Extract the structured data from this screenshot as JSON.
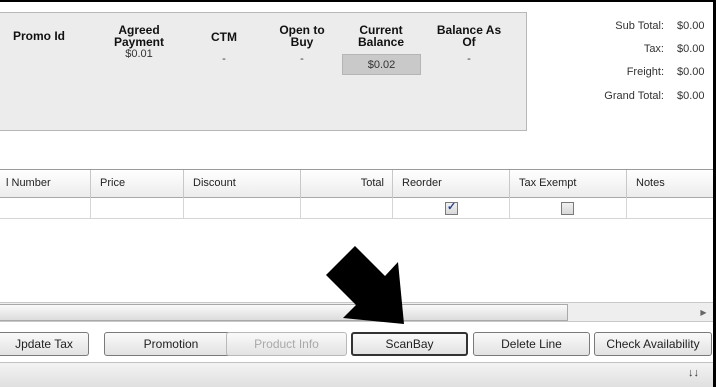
{
  "promo": {
    "headers": {
      "promo_id": "Promo Id",
      "agreed_payment_line1": "Agreed",
      "agreed_payment_line2": "Payment",
      "ctm": "CTM",
      "open_to_buy_line1": "Open to",
      "open_to_buy_line2": "Buy",
      "current_balance_line1": "Current",
      "current_balance_line2": "Balance",
      "balance_as_of_line1": "Balance As",
      "balance_as_of_line2": "Of"
    },
    "values": {
      "agreed_payment": "$0.01",
      "ctm": "-",
      "open_to_buy": "-",
      "current_balance": "$0.02",
      "balance_as_of": "-"
    }
  },
  "totals": {
    "subtotal_label": "Sub Total:",
    "subtotal_value": "$0.00",
    "tax_label": "Tax:",
    "tax_value": "$0.00",
    "freight_label": "Freight:",
    "freight_value": "$0.00",
    "grandtotal_label": "Grand Total:",
    "grandtotal_value": "$0.00"
  },
  "grid": {
    "columns": [
      "l Number",
      "Price",
      "Discount",
      "Total",
      "Reorder",
      "Tax Exempt",
      "Notes"
    ],
    "row": {
      "reorder_checked": true,
      "tax_exempt_checked": false
    }
  },
  "buttons": {
    "update_tax": "Jpdate Tax",
    "promotion": "Promotion",
    "product_info": "Product Info",
    "scanbay": "ScanBay",
    "delete_line": "Delete Line",
    "check_availability": "Check Availability"
  },
  "icons": {
    "expand": "double-chevron-down-icon",
    "scroll_right": "scroll-right-arrow-icon",
    "callout": "black-arrow-pointer"
  }
}
